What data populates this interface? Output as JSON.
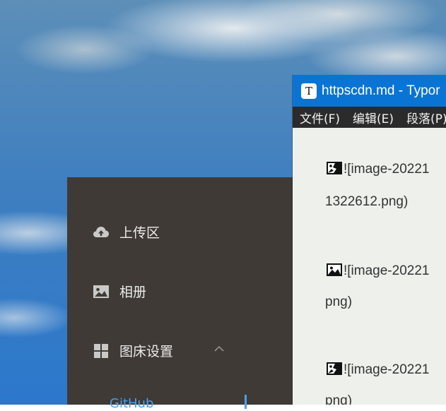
{
  "picgo": {
    "nav": [
      {
        "label": "上传区",
        "icon": "upload-cloud-icon"
      },
      {
        "label": "相册",
        "icon": "image-icon"
      },
      {
        "label": "图床设置",
        "icon": "grid-icon"
      }
    ],
    "sub_item": "GitHub",
    "accent_color": "#4a9ff5",
    "panel_color": "#3f3a35"
  },
  "typora": {
    "app_icon_letter": "T",
    "title": "httpscdn.md - Typor",
    "menu": [
      "文件(F)",
      "编辑(E)",
      "段落(P)"
    ],
    "lines": [
      {
        "text": "![image-20221",
        "icon": "broken-image-icon"
      },
      {
        "text": "1322612.png)"
      },
      {
        "text": "![image-20221",
        "icon": "image-icon"
      },
      {
        "text": "png)"
      },
      {
        "text": "![image-20221",
        "icon": "broken-image-icon"
      },
      {
        "text": "png)"
      }
    ],
    "titlebar_color": "#0a74d4"
  }
}
